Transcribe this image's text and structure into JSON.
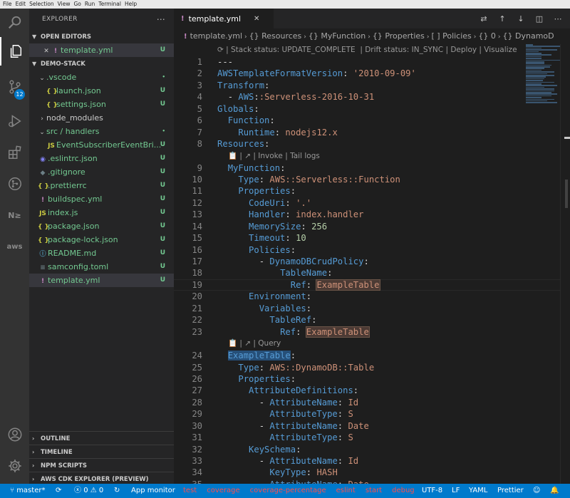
{
  "menu": [
    "File",
    "Edit",
    "Selection",
    "View",
    "Go",
    "Run",
    "Terminal",
    "Help"
  ],
  "sidebar": {
    "title": "EXPLORER",
    "open_editors": {
      "label": "OPEN EDITORS",
      "items": [
        {
          "icon": "!",
          "name": "template.yml",
          "status": "U"
        }
      ]
    },
    "folder": {
      "label": "DEMO-STACK",
      "items": [
        {
          "name": ".vscode",
          "type": "folder",
          "depth": 1,
          "expanded": true,
          "status": "•"
        },
        {
          "name": "launch.json",
          "icon": "{ }",
          "depth": 2,
          "status": "U"
        },
        {
          "name": "settings.json",
          "icon": "{ }",
          "depth": 2,
          "status": "U"
        },
        {
          "name": "node_modules",
          "type": "folder",
          "depth": 1,
          "expanded": false,
          "status": ""
        },
        {
          "name": "src / handlers",
          "type": "folder",
          "depth": 1,
          "expanded": true,
          "status": "•"
        },
        {
          "name": "EventSubscriberEventBri...",
          "icon": "JS",
          "depth": 2,
          "status": "U"
        },
        {
          "name": ".eslintrc.json",
          "icon": "◉",
          "depth": 1,
          "status": "U"
        },
        {
          "name": ".gitignore",
          "icon": "◆",
          "depth": 1,
          "status": "U"
        },
        {
          "name": ".prettierrc",
          "icon": "{ }",
          "depth": 1,
          "status": "U"
        },
        {
          "name": "buildspec.yml",
          "icon": "!",
          "depth": 1,
          "status": "U"
        },
        {
          "name": "index.js",
          "icon": "JS",
          "depth": 1,
          "status": "U"
        },
        {
          "name": "package.json",
          "icon": "{ }",
          "depth": 1,
          "status": "U"
        },
        {
          "name": "package-lock.json",
          "icon": "{ }",
          "depth": 1,
          "status": "U"
        },
        {
          "name": "README.md",
          "icon": "ⓘ",
          "depth": 1,
          "status": "U"
        },
        {
          "name": "samconfig.toml",
          "icon": "≡",
          "depth": 1,
          "status": "U"
        },
        {
          "name": "template.yml",
          "icon": "!",
          "depth": 1,
          "status": "U"
        }
      ]
    },
    "bottom_sections": [
      "OUTLINE",
      "TIMELINE",
      "NPM SCRIPTS",
      "AWS CDK EXPLORER (PREVIEW)"
    ]
  },
  "activity": {
    "scm_badge": "12"
  },
  "editor": {
    "tab": {
      "name": "template.yml"
    },
    "breadcrumb": [
      "template.yml",
      "Resources",
      "MyFunction",
      "Properties",
      "Policies",
      "0",
      "DynamoD"
    ],
    "breadcrumb_icons": [
      "{}",
      "{}",
      "{}",
      "[ ]",
      "{}",
      "{}"
    ],
    "lens_top": "⟳ | Stack status: UPDATE_COMPLETE  | Drift status: IN_SYNC | Deploy | Visualize",
    "lens_function": "📋 | ↗ | Invoke | Tail logs",
    "lens_table": "📋 | ↗ | Query",
    "lines": [
      {
        "n": "1",
        "t": "---"
      },
      {
        "n": "2",
        "t": "AWSTemplateFormatVersion: '2010-09-09'"
      },
      {
        "n": "3",
        "t": "Transform:"
      },
      {
        "n": "4",
        "t": "  - AWS::Serverless-2016-10-31"
      },
      {
        "n": "5",
        "t": "Globals:"
      },
      {
        "n": "6",
        "t": "  Function:"
      },
      {
        "n": "7",
        "t": "    Runtime: nodejs12.x"
      },
      {
        "n": "8",
        "t": "Resources:"
      },
      {
        "n": "9",
        "t": "  MyFunction:"
      },
      {
        "n": "10",
        "t": "    Type: AWS::Serverless::Function"
      },
      {
        "n": "11",
        "t": "    Properties:"
      },
      {
        "n": "12",
        "t": "      CodeUri: '.'"
      },
      {
        "n": "13",
        "t": "      Handler: index.handler"
      },
      {
        "n": "14",
        "t": "      MemorySize: 256"
      },
      {
        "n": "15",
        "t": "      Timeout: 10"
      },
      {
        "n": "16",
        "t": "      Policies:"
      },
      {
        "n": "17",
        "t": "        - DynamoDBCrudPolicy:"
      },
      {
        "n": "18",
        "t": "            TableName:"
      },
      {
        "n": "19",
        "t": "              Ref: ExampleTable"
      },
      {
        "n": "20",
        "t": "      Environment:"
      },
      {
        "n": "21",
        "t": "        Variables:"
      },
      {
        "n": "22",
        "t": "          TableRef:"
      },
      {
        "n": "23",
        "t": "            Ref: ExampleTable"
      },
      {
        "n": "24",
        "t": "  ExampleTable:"
      },
      {
        "n": "25",
        "t": "    Type: AWS::DynamoDB::Table"
      },
      {
        "n": "26",
        "t": "    Properties:"
      },
      {
        "n": "27",
        "t": "      AttributeDefinitions:"
      },
      {
        "n": "28",
        "t": "        - AttributeName: Id"
      },
      {
        "n": "29",
        "t": "          AttributeType: S"
      },
      {
        "n": "30",
        "t": "        - AttributeName: Date"
      },
      {
        "n": "31",
        "t": "          AttributeType: S"
      },
      {
        "n": "32",
        "t": "      KeySchema:"
      },
      {
        "n": "33",
        "t": "        - AttributeName: Id"
      },
      {
        "n": "34",
        "t": "          KeyType: HASH"
      },
      {
        "n": "35",
        "t": "        - AttributeName: Date"
      }
    ]
  },
  "statusbar": {
    "branch": "master*",
    "errors": "0",
    "warnings": "0",
    "app_monitor": "App monitor",
    "scripts": [
      "test",
      "coverage",
      "coverage-percentage",
      "eslint",
      "start",
      "debug"
    ],
    "encoding": "UTF-8",
    "eol": "LF",
    "language": "YAML",
    "formatter": "Prettier"
  },
  "colors": {
    "accent": "#007acc",
    "statusbar": "#007acc",
    "git_untracked": "#73c991",
    "script_red": "#ff4d4d"
  }
}
